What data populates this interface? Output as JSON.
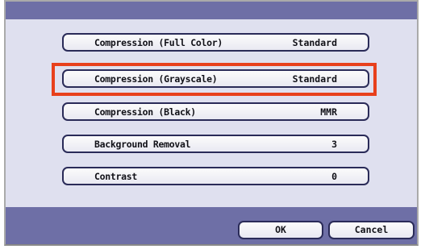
{
  "settings": [
    {
      "label": "Compression (Full Color)",
      "value": "Standard"
    },
    {
      "label": "Compression (Grayscale)",
      "value": "Standard"
    },
    {
      "label": "Compression (Black)",
      "value": "MMR"
    },
    {
      "label": "Background Removal",
      "value": "3"
    },
    {
      "label": "Contrast",
      "value": "0"
    }
  ],
  "footer": {
    "ok_label": "OK",
    "cancel_label": "Cancel"
  },
  "colors": {
    "panel_bar": "#6e6fa6",
    "panel_bg": "#dfe0ef",
    "button_border": "#2a2b58",
    "highlight": "#e8401c"
  }
}
